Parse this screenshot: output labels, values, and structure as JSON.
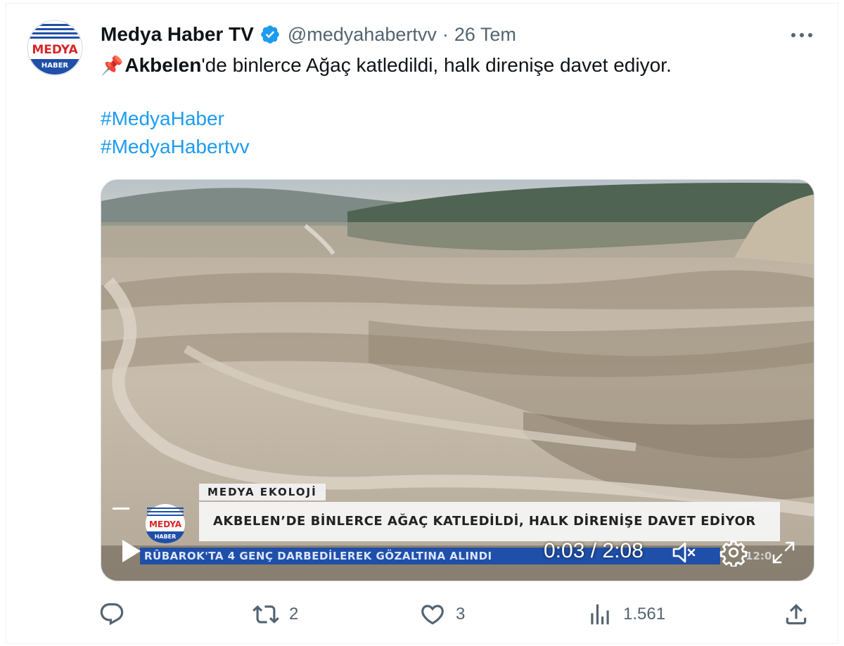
{
  "tweet": {
    "avatar": {
      "line1": "MEDYA",
      "line2": "HABER"
    },
    "display_name": "Medya Haber TV",
    "handle": "@medyahabertvv",
    "separator": "·",
    "date": "26 Tem",
    "text_pin": "📌",
    "text_bold": "Akbelen",
    "text_rest": "'de binlerce Ağaç katledildi, halk direnişe davet ediyor.",
    "hashtags": [
      "#MedyaHaber",
      "#MedyaHabertvv"
    ]
  },
  "video": {
    "category_label": "MEDYA EKOLOJİ",
    "headline": "AKBELEN’DE BİNLERCE AĞAÇ KATLEDİLDİ, HALK DİRENİŞE DAVET EDİYOR",
    "ticker": "RÛBAROK'TA 4 GENÇ DARBEDİLEREK GÖZALTINA ALINDI",
    "clock": "12:0",
    "logo_line1": "MEDYA",
    "logo_line2": "HABER",
    "time_display": "0:03 / 2:08",
    "progress": 0.024
  },
  "actions": {
    "reply_count": "",
    "retweet_count": "2",
    "like_count": "3",
    "view_count": "1.561"
  },
  "colors": {
    "accent": "#1d9bf0",
    "text": "#0f1419",
    "secondary": "#536471",
    "logo_red": "#d7262a",
    "logo_blue": "#1f4fa8"
  },
  "icons": [
    "avatar-logo",
    "verified-badge-icon",
    "more-icon",
    "pin-icon",
    "play-icon",
    "volume-muted-icon",
    "gear-icon",
    "fullscreen-icon",
    "reply-icon",
    "retweet-icon",
    "like-icon",
    "views-icon",
    "share-icon"
  ]
}
